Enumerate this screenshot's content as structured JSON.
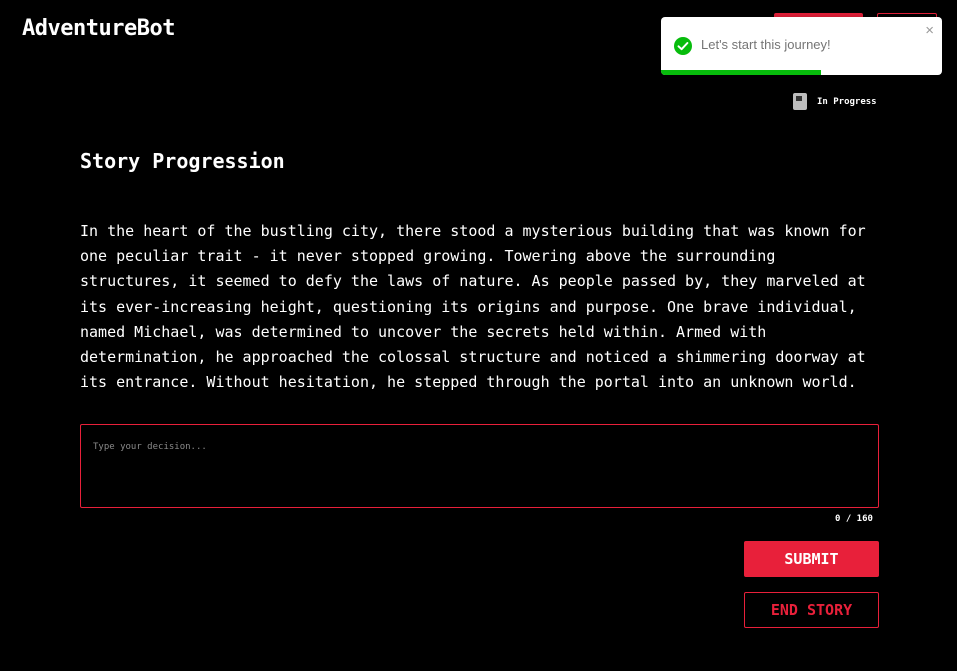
{
  "app": {
    "title": "AdventureBot"
  },
  "toast": {
    "message": "Let's start this journey!",
    "close_glyph": "×",
    "icon": "check-circle-icon",
    "progress_fraction": 0.57,
    "accent": "#07bc0c"
  },
  "status": {
    "label": "In Progress",
    "icon": "book-icon"
  },
  "story": {
    "heading": "Story Progression",
    "text": "In the heart of the bustling city, there stood a mysterious building that was known for one peculiar trait - it never stopped growing. Towering above the surrounding structures, it seemed to defy the laws of nature. As people passed by, they marveled at its ever-increasing height, questioning its origins and purpose. One brave individual, named Michael, was determined to uncover the secrets held within. Armed with determination, he approached the colossal structure and noticed a shimmering doorway at its entrance. Without hesitation, he stepped through the portal into an unknown world."
  },
  "decision": {
    "placeholder": "Type your decision...",
    "value": "",
    "char_count": "0 / 160"
  },
  "actions": {
    "submit_label": "SUBMIT",
    "end_label": "END STORY"
  },
  "colors": {
    "brand_red": "#e8203a",
    "background": "#000000"
  }
}
